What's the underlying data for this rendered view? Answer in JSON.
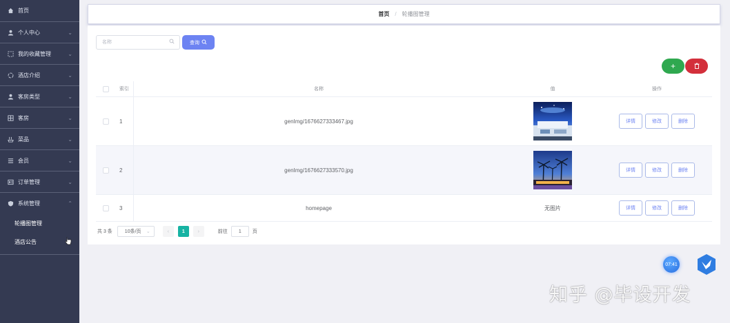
{
  "sidebar": {
    "items": [
      {
        "label": "首页",
        "icon": "home-icon"
      },
      {
        "label": "个人中心",
        "icon": "user-icon"
      },
      {
        "label": "我的收藏管理",
        "icon": "collection-icon"
      },
      {
        "label": "酒店介绍",
        "icon": "circle-icon"
      },
      {
        "label": "客房类型",
        "icon": "user-icon"
      },
      {
        "label": "客房",
        "icon": "grid-icon"
      },
      {
        "label": "菜品",
        "icon": "dish-icon"
      },
      {
        "label": "会员",
        "icon": "list-icon"
      },
      {
        "label": "订单管理",
        "icon": "order-icon"
      },
      {
        "label": "系统管理",
        "icon": "shield-icon"
      }
    ],
    "submenu": [
      {
        "label": "轮播图管理"
      },
      {
        "label": "酒店公告"
      }
    ]
  },
  "header": {
    "home": "首页",
    "separator": "/",
    "current": "轮播图管理"
  },
  "search": {
    "placeholder": "名称",
    "query_label": "查询"
  },
  "toolbar": {
    "add_label": "+",
    "delete_icon": "trash-icon"
  },
  "table": {
    "headers": {
      "index": "索引",
      "name": "名称",
      "picture": "值",
      "actions": "操作"
    },
    "rows": [
      {
        "index": "1",
        "name": "genImg/1676627333467.jpg",
        "picture": "",
        "has_image": true
      },
      {
        "index": "2",
        "name": "genImg/1676627333570.jpg",
        "picture": "",
        "has_image": true
      },
      {
        "index": "3",
        "name": "homepage",
        "picture": "无图片",
        "has_image": false
      }
    ],
    "actions": {
      "detail": "详情",
      "edit": "修改",
      "delete": "删除"
    }
  },
  "pagination": {
    "total": "共 3 条",
    "page_size": "10条/页",
    "prev": "‹",
    "current_page": "1",
    "next": "›",
    "goto_label": "前往",
    "goto_value": "1",
    "page_unit": "页"
  },
  "floating": {
    "time": "07:41"
  },
  "watermark": "知乎 @毕设开发",
  "colors": {
    "sidebar_bg": "#343a52",
    "primary": "#6d83f2",
    "add": "#2fa84f",
    "delete": "#d32f3b",
    "page_active": "#17b3a3"
  }
}
